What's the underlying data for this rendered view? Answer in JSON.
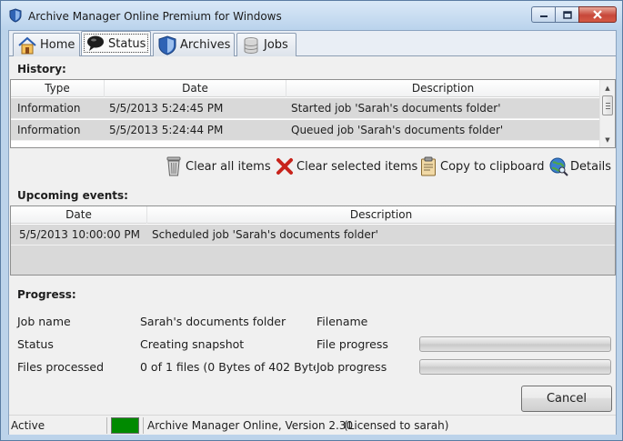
{
  "window": {
    "title": "Archive Manager Online Premium for Windows",
    "caption_buttons": [
      "minimize-icon",
      "maximize-icon",
      "close-icon"
    ]
  },
  "tabs": [
    {
      "label": "Home",
      "icon": "home-icon",
      "active": false
    },
    {
      "label": "Status",
      "icon": "chat-bubble-icon",
      "active": true
    },
    {
      "label": "Archives",
      "icon": "shield-icon",
      "active": false
    },
    {
      "label": "Jobs",
      "icon": "database-icon",
      "active": false
    }
  ],
  "history": {
    "label": "History:",
    "columns": [
      "Type",
      "Date",
      "Description"
    ],
    "rows": [
      {
        "type": "Information",
        "date": "5/5/2013 5:24:45 PM",
        "description": "Started job 'Sarah's documents folder'"
      },
      {
        "type": "Information",
        "date": "5/5/2013 5:24:44 PM",
        "description": "Queued job 'Sarah's documents folder'"
      }
    ]
  },
  "toolbar": {
    "clear_all": "Clear all items",
    "clear_selected": "Clear selected items",
    "copy_clipboard": "Copy to clipboard",
    "details": "Details"
  },
  "upcoming": {
    "label": "Upcoming events:",
    "columns": [
      "Date",
      "Description"
    ],
    "rows": [
      {
        "date": "5/5/2013 10:00:00 PM",
        "description": "Scheduled job 'Sarah's documents folder'"
      }
    ]
  },
  "progress": {
    "label": "Progress:",
    "job_name_label": "Job name",
    "job_name_value": "Sarah's documents folder",
    "status_label": "Status",
    "status_value": "Creating snapshot",
    "files_processed_label": "Files processed",
    "files_processed_value": "0 of 1 files (0 Bytes of 402 Byte",
    "filename_label": "Filename",
    "filename_value": "",
    "file_progress_label": "File progress",
    "file_progress_fraction": 0,
    "job_progress_label": "Job progress",
    "job_progress_fraction": 0,
    "cancel_label": "Cancel"
  },
  "statusbar": {
    "state": "Active",
    "indicator_color": "#008a00",
    "version": "Archive Manager Online, Version 2.30",
    "license": "(Licensed to sarah)"
  }
}
